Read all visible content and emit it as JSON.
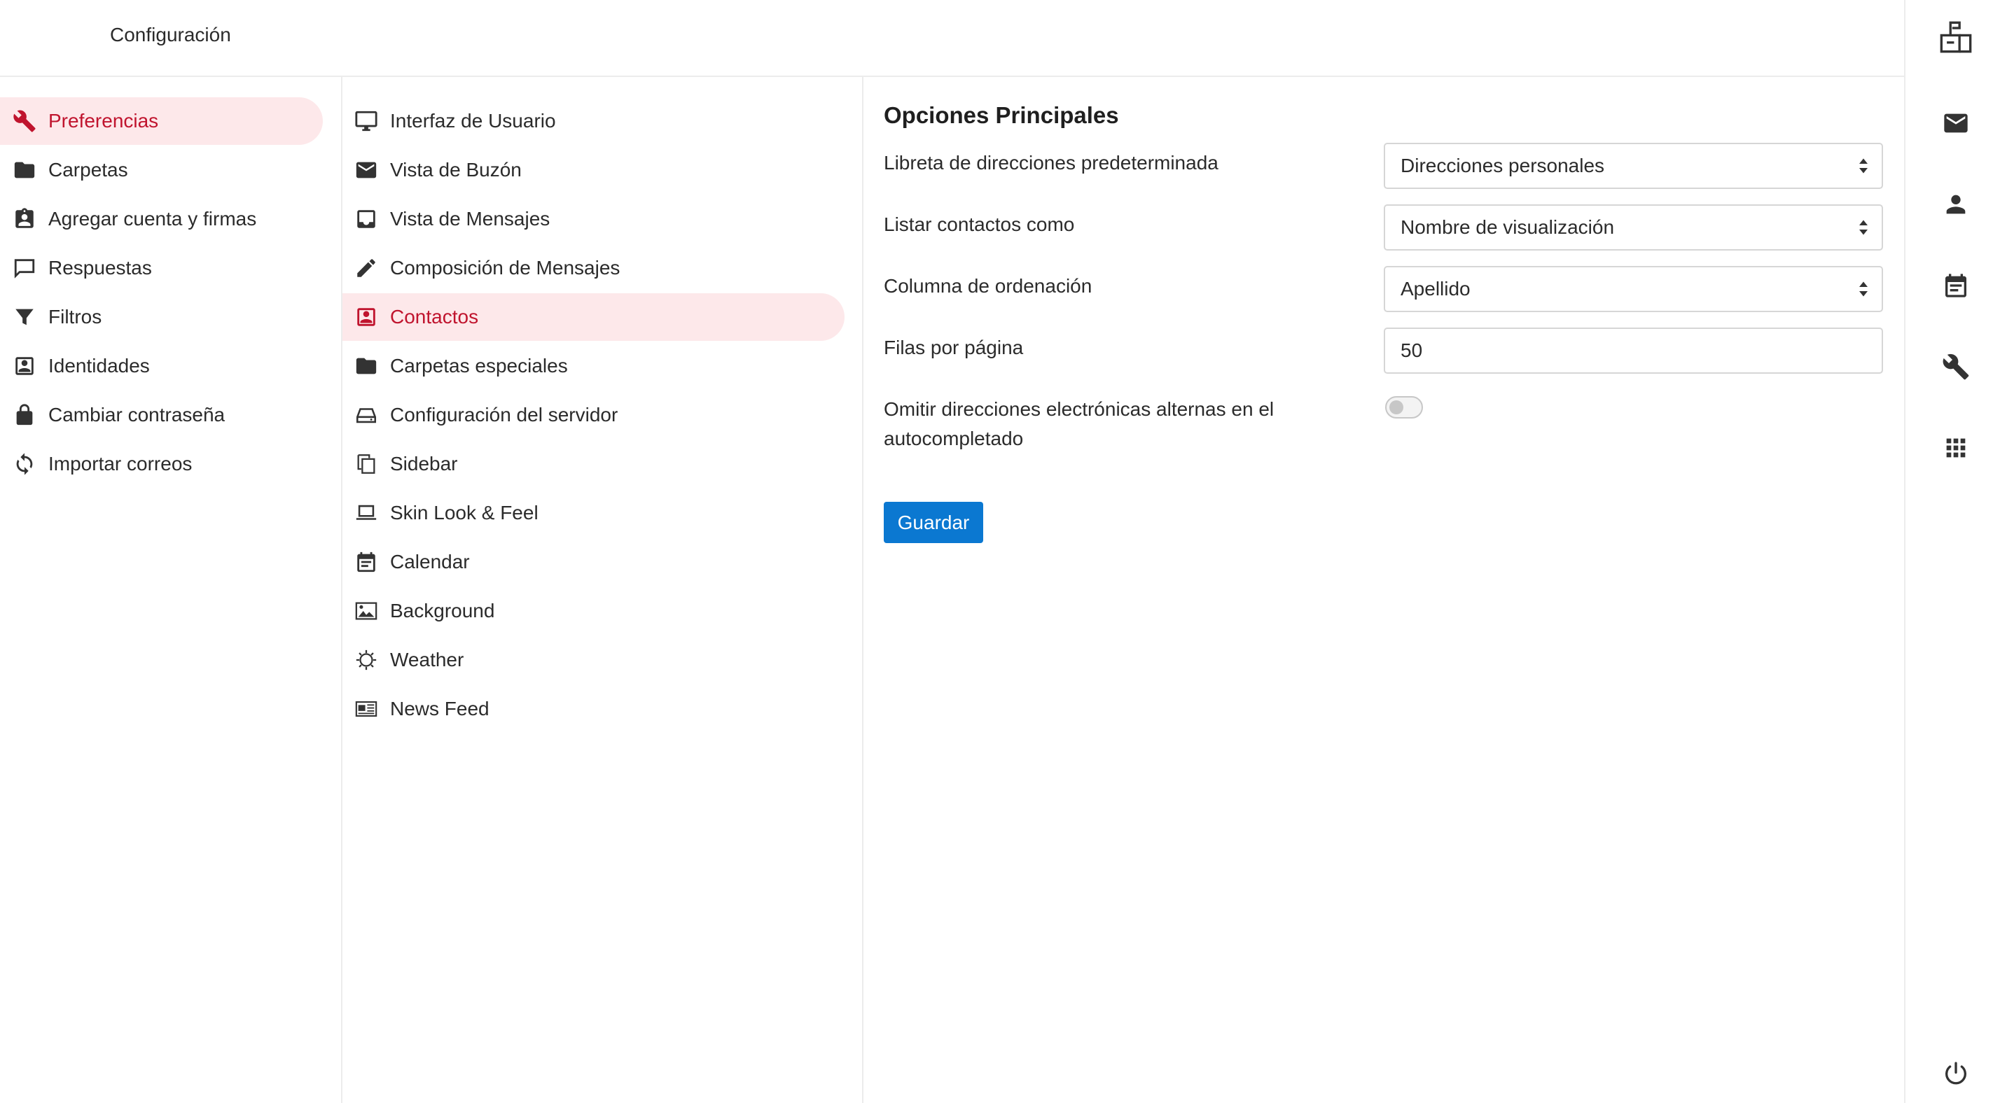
{
  "header": {
    "title": "Configuración",
    "logo_icon": "mailbox-icon"
  },
  "settings_nav": {
    "items": [
      {
        "label": "Preferencias",
        "icon": "wrench-icon",
        "active": true
      },
      {
        "label": "Carpetas",
        "icon": "folder-icon"
      },
      {
        "label": "Agregar cuenta y firmas",
        "icon": "account-badge-icon"
      },
      {
        "label": "Respuestas",
        "icon": "chat-bubble-icon"
      },
      {
        "label": "Filtros",
        "icon": "filter-icon"
      },
      {
        "label": "Identidades",
        "icon": "identity-card-icon"
      },
      {
        "label": "Cambiar contraseña",
        "icon": "lock-icon"
      },
      {
        "label": "Importar correos",
        "icon": "sync-icon"
      }
    ]
  },
  "sections_nav": {
    "items": [
      {
        "label": "Interfaz de Usuario",
        "icon": "monitor-icon"
      },
      {
        "label": "Vista de Buzón",
        "icon": "envelope-icon"
      },
      {
        "label": "Vista de Mensajes",
        "icon": "inbox-tray-icon"
      },
      {
        "label": "Composición de Mensajes",
        "icon": "pencil-icon"
      },
      {
        "label": "Contactos",
        "icon": "contact-card-icon",
        "active": true
      },
      {
        "label": "Carpetas especiales",
        "icon": "folder-icon"
      },
      {
        "label": "Configuración del servidor",
        "icon": "server-drive-icon"
      },
      {
        "label": "Sidebar",
        "icon": "copy-pages-icon"
      },
      {
        "label": "Skin Look & Feel",
        "icon": "laptop-icon"
      },
      {
        "label": "Calendar",
        "icon": "calendar-icon"
      },
      {
        "label": "Background",
        "icon": "image-icon"
      },
      {
        "label": "Weather",
        "icon": "sun-icon"
      },
      {
        "label": "News Feed",
        "icon": "newspaper-icon"
      }
    ]
  },
  "main": {
    "section_title": "Opciones Principales",
    "fields": {
      "address_book": {
        "label": "Libreta de direcciones predeterminada",
        "value": "Direcciones personales"
      },
      "list_contacts_as": {
        "label": "Listar contactos como",
        "value": "Nombre de visualización"
      },
      "sort_column": {
        "label": "Columna de ordenación",
        "value": "Apellido"
      },
      "rows_per_page": {
        "label": "Filas por página",
        "value": "50"
      },
      "skip_alternate": {
        "label": "Omitir direcciones electrónicas alternas en el autocompletado",
        "enabled": false
      }
    },
    "save_label": "Guardar"
  },
  "right_rail": {
    "items": [
      "mail-icon",
      "contacts-person-icon",
      "calendar-icon",
      "settings-wrench-icon",
      "apps-grid-icon"
    ],
    "logout_icon": "power-icon"
  },
  "colors": {
    "accent_active_text": "#c0142e",
    "accent_active_bg": "#fde8ea",
    "primary_button": "#0b78d1"
  }
}
